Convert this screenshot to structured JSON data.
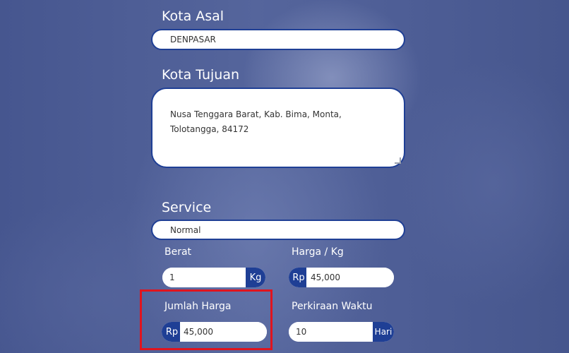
{
  "origin": {
    "label": "Kota Asal",
    "value": "DENPASAR"
  },
  "destination": {
    "label": "Kota Tujuan",
    "value": "Nusa Tenggara Barat, Kab. Bima, Monta, Tolotangga, 84172"
  },
  "service": {
    "label": "Service",
    "value": "Normal"
  },
  "weight": {
    "label": "Berat",
    "value": "1",
    "unit": "Kg"
  },
  "price_per_kg": {
    "label": "Harga / Kg",
    "currency": "Rp",
    "value": "45,000"
  },
  "total_price": {
    "label": "Jumlah Harga",
    "currency": "Rp",
    "value": "45,000"
  },
  "estimated_time": {
    "label": "Perkiraan Waktu",
    "value": "10",
    "unit": "Hari"
  },
  "colors": {
    "background": "#4a5a92",
    "field_border": "#1f3f95",
    "addon_fill": "#1f3f95",
    "highlight_box": "#e0141e"
  }
}
